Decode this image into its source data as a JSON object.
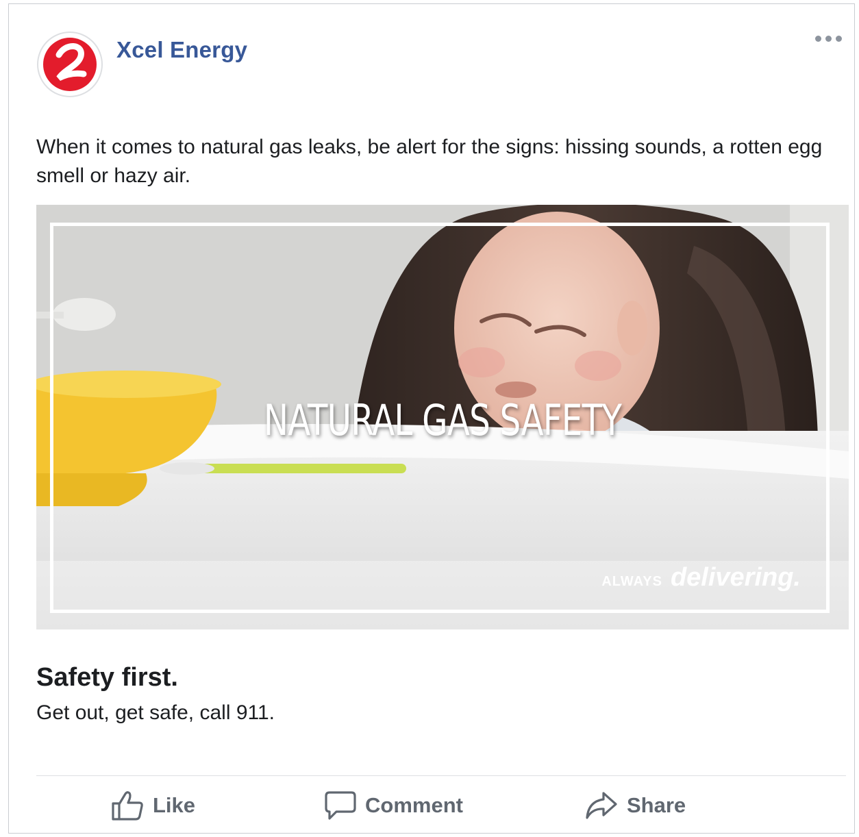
{
  "post": {
    "page_name": "Xcel Energy",
    "text": "When it comes to natural gas leaks, be alert for the signs: hissing sounds, a rotten egg smell or hazy air.",
    "more_icon": "more-options-icon",
    "avatar_icon": "xcel-energy-logo",
    "brand_color": "#e31c2c",
    "name_color": "#385898"
  },
  "media": {
    "overlay_title": "NATURAL GAS SAFETY",
    "tagline_small": "ALWAYS",
    "tagline_big": "delivering."
  },
  "link": {
    "headline": "Safety first.",
    "description": "Get out, get safe, call 911."
  },
  "actions": {
    "like_label": "Like",
    "comment_label": "Comment",
    "share_label": "Share",
    "like_icon": "thumbs-up-icon",
    "comment_icon": "comment-bubble-icon",
    "share_icon": "share-arrow-icon"
  }
}
